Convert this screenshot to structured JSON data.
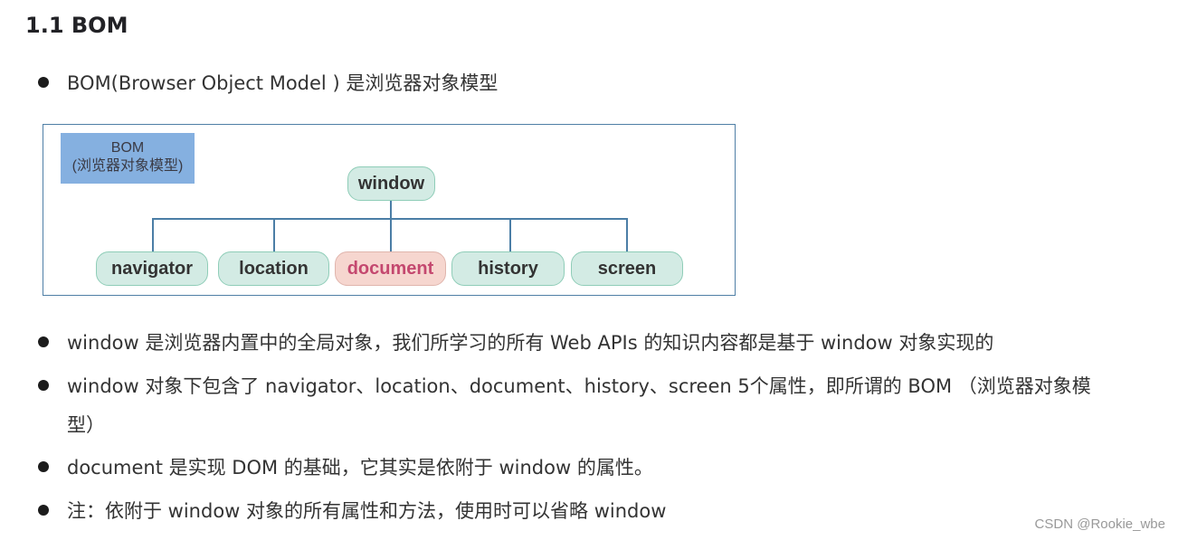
{
  "heading": "1.1 BOM",
  "intro_bullet": "BOM(Browser Object Model ) 是浏览器对象模型",
  "diagram": {
    "label_line1": "BOM",
    "label_line2": "(浏览器对象模型)",
    "root": "window",
    "children": [
      "navigator",
      "location",
      "document",
      "history",
      "screen"
    ],
    "highlighted_child": "document",
    "colors": {
      "node_fill": "#d3ebe4",
      "node_border": "#8fcdb8",
      "highlight_fill": "#f6d6cf",
      "highlight_text": "#c4486f",
      "label_fill": "#85b0e0",
      "connector": "#4b7ea6"
    }
  },
  "bullets": [
    "window 是浏览器内置中的全局对象，我们所学习的所有 Web APIs 的知识内容都是基于 window 对象实现的",
    "window 对象下包含了 navigator、location、document、history、screen 5个属性，即所谓的 BOM （浏览器对象模",
    "document 是实现 DOM 的基础，它其实是依附于 window 的属性。",
    "注：依附于 window 对象的所有属性和方法，使用时可以省略 window"
  ],
  "bullet2_continuation": "型）",
  "watermark": "CSDN @Rookie_wbe"
}
